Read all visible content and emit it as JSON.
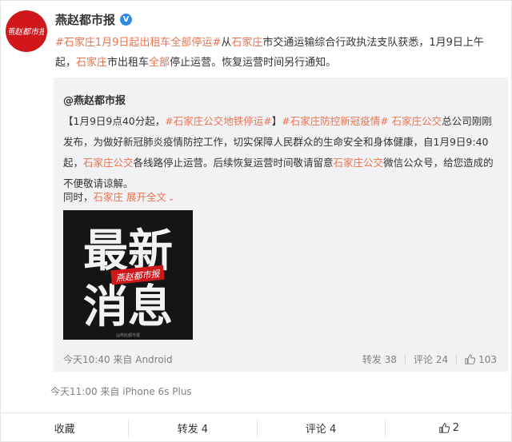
{
  "post": {
    "author": "燕赵都市报",
    "verified_mark": "V",
    "avatar_text": "燕赵都市报",
    "text": {
      "topic": "#石家庄1月9日起出租车全部停运#",
      "t1": "从",
      "kw1": "石家庄",
      "t2": "市交通运输综合行政执法支队获悉，1月9日上午起，",
      "kw2": "石家庄",
      "t3": "市出租车",
      "kw3": "全部",
      "t4": "停止运营。恢复运营时间另行通知。"
    },
    "meta": {
      "time": "今天11:00",
      "from": "来自 iPhone 6s Plus"
    }
  },
  "quoted": {
    "author": "@燕赵都市报",
    "text": {
      "bracket": "【1月9日9点40分起，",
      "topic1": "#石家庄公交地铁停运#",
      "t1": "】",
      "topic2": "#石家庄防控新冠疫情#",
      "t2": " ",
      "kw1": "石家庄公交",
      "t3": "总公司刚刚发布，为做好新冠肺炎疫情防控工作，切实保障人民群众的生命安全和身体健康，自1月9日9:40起，",
      "kw2": "石家庄公交",
      "t4": "各线路停止运营。后续恢复运营时间敬请留意",
      "kw3": "石家庄公交",
      "t5": "微信公众号，给您造成的不便敬请谅解。"
    },
    "extra": {
      "prefix": "同时，",
      "location": "石家庄",
      "expand": "展开全文"
    },
    "image": {
      "line1": "最新",
      "line2": "消息",
      "stamp": "燕赵都市报",
      "watermark": "@燕赵都市报"
    },
    "meta": {
      "time": "今天10:40",
      "from": "来自 Android"
    },
    "actions": {
      "repost": "转发 38",
      "comment": "评论 24",
      "like": "103"
    }
  },
  "bottom_bar": {
    "favorite": "收藏",
    "repost": "转发 4",
    "comment": "评论 4",
    "like": "2"
  },
  "colors": {
    "accent": "#eb7350",
    "brand_red": "#d0171c",
    "verified_blue": "#2e8ae8"
  }
}
